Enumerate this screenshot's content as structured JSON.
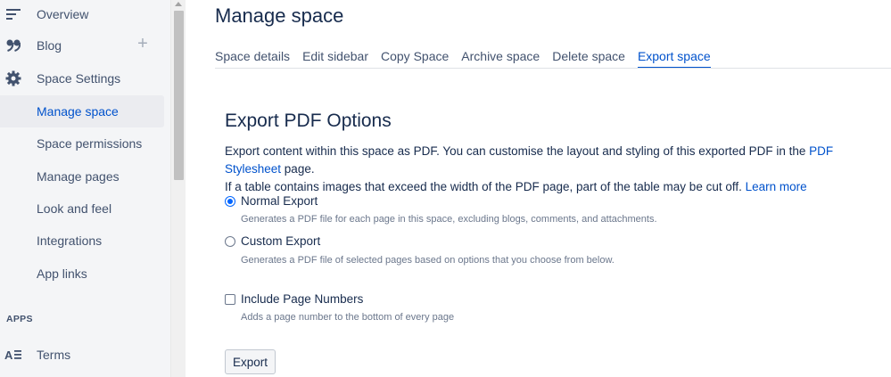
{
  "sidebar": {
    "items": [
      {
        "label": "Overview",
        "icon": "overview-icon"
      },
      {
        "label": "Blog",
        "icon": "quote-icon"
      },
      {
        "label": "Space Settings",
        "icon": "gear-icon"
      },
      {
        "label": "Manage space"
      },
      {
        "label": "Space permissions"
      },
      {
        "label": "Manage pages"
      },
      {
        "label": "Look and feel"
      },
      {
        "label": "Integrations"
      },
      {
        "label": "App links"
      }
    ],
    "apps_heading": "APPS",
    "apps": [
      {
        "label": "Terms",
        "icon": "terms-icon"
      }
    ],
    "blog_add": "+"
  },
  "main": {
    "title": "Manage space",
    "tabs": [
      {
        "label": "Space details"
      },
      {
        "label": "Edit sidebar"
      },
      {
        "label": "Copy Space"
      },
      {
        "label": "Archive space"
      },
      {
        "label": "Delete space"
      },
      {
        "label": "Export space"
      }
    ],
    "section_title": "Export PDF Options",
    "desc_part1": "Export content within this space as PDF. You can customise the layout and styling of this exported PDF in the ",
    "desc_link1": "PDF Stylesheet",
    "desc_part2": " page.",
    "desc_part3": "If a table contains images that exceed the width of the PDF page, part of the table may be cut off. ",
    "desc_link2": "Learn more",
    "options": [
      {
        "label": "Normal Export",
        "help": "Generates a PDF file for each page in this space, excluding blogs, comments, and attachments."
      },
      {
        "label": "Custom Export",
        "help": "Generates a PDF file of selected pages based on options that you choose from below."
      }
    ],
    "include_page_numbers": {
      "label": "Include Page Numbers",
      "help": "Adds a page number to the bottom of every page"
    },
    "export_button": "Export"
  },
  "colors": {
    "accent": "#0052CC",
    "sidebar_bg": "#F4F5F7",
    "text": "#172B4D"
  }
}
